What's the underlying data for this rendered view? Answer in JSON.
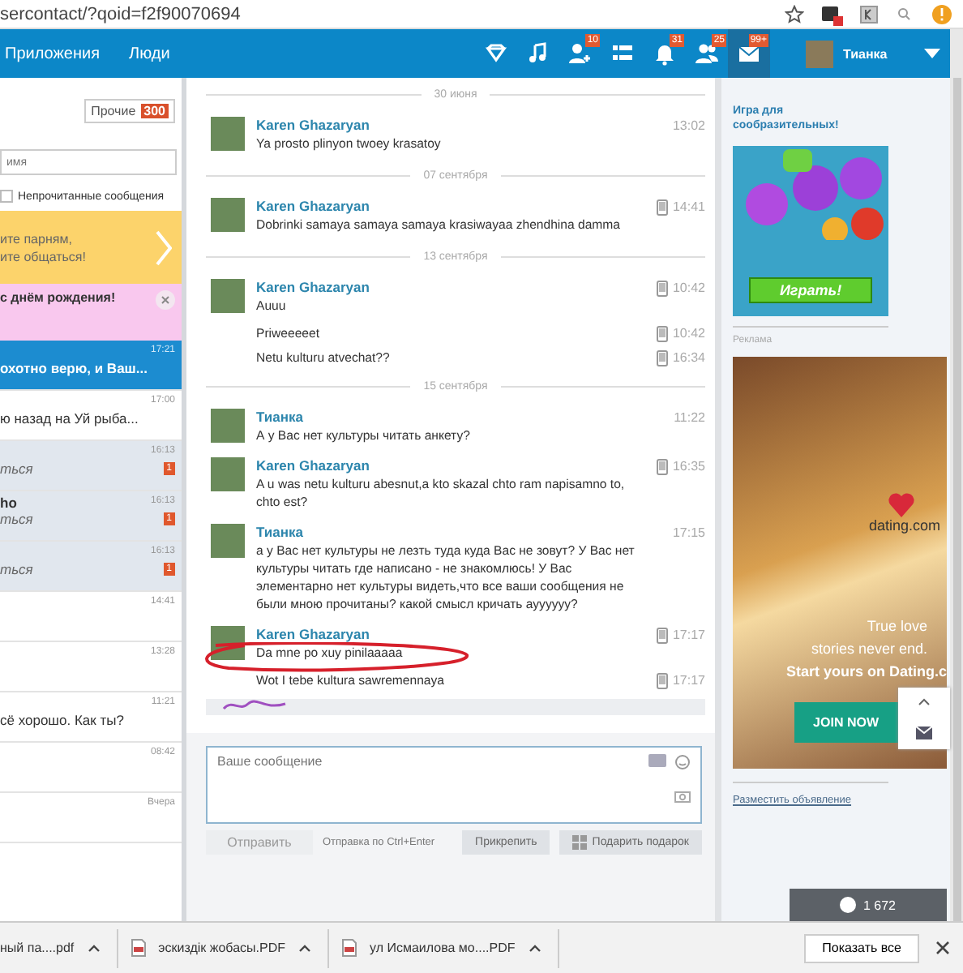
{
  "browser": {
    "url": "sercontact/?qoid=f2f90070694"
  },
  "nav": {
    "links": [
      "Приложения",
      "Люди"
    ],
    "icons": [
      {
        "kind": "diamond",
        "selected": false
      },
      {
        "kind": "music",
        "selected": false
      },
      {
        "kind": "friends",
        "badge": "10",
        "selected": false
      },
      {
        "kind": "list",
        "selected": false
      },
      {
        "kind": "bell",
        "badge": "31",
        "selected": false
      },
      {
        "kind": "people",
        "badge": "25",
        "selected": false
      },
      {
        "kind": "mail",
        "badge": "99+",
        "selected": true
      }
    ],
    "user": {
      "name": "Тианка"
    }
  },
  "sidebar": {
    "filter_tab": {
      "label": "Прочие",
      "count": "300"
    },
    "search": {
      "placeholder": "имя"
    },
    "unread_filter": {
      "label": "Непрочитанные сообщения",
      "checked": false
    },
    "promo": {
      "lines": [
        "ите парням,",
        "ите общаться!"
      ]
    },
    "birthday": {
      "text": "с днём рождения!"
    },
    "conversations": [
      {
        "preview": "охотно верю, и Ваш...",
        "time": "17:21",
        "selected": true
      },
      {
        "preview": "ю назад на Уй рыба...",
        "time": "17:00",
        "selected": false
      },
      {
        "preview": "ться",
        "time": "16:13",
        "selected": false,
        "unread": "1"
      },
      {
        "name": "ho",
        "preview": "ться",
        "time": "16:13",
        "selected": false,
        "unread": "1"
      },
      {
        "preview": "ться",
        "time": "16:13",
        "selected": false,
        "unread": "1"
      },
      {
        "time": "14:41",
        "selected": false
      },
      {
        "time": "13:28",
        "selected": false
      },
      {
        "preview": "сё хорошо. Как ты?",
        "time": "11:21",
        "selected": false
      },
      {
        "time": "08:42",
        "selected": false
      },
      {
        "time": "Вчера",
        "selected": false
      }
    ]
  },
  "chat": {
    "days": [
      {
        "date": "30 июня",
        "messages": [
          {
            "author": "Karen Ghazaryan",
            "text": "Ya prosto plinyon twoey krasatoy",
            "time": "13:02"
          }
        ]
      },
      {
        "date": "07 сентября",
        "messages": [
          {
            "author": "Karen Ghazaryan",
            "text": "Dobrinki samaya samaya samaya krasiwayaa zhendhina damma",
            "time": "14:41",
            "mobile": true
          }
        ]
      },
      {
        "date": "13 сентября",
        "messages": [
          {
            "author": "Karen Ghazaryan",
            "text": "Auuu",
            "time": "10:42",
            "mobile": true
          },
          {
            "text": "Priweeeeet",
            "time": "10:42",
            "mobile": true
          },
          {
            "text": "Netu kulturu atvechat??",
            "time": "16:34",
            "mobile": true
          }
        ]
      },
      {
        "date": "15 сентября",
        "messages": [
          {
            "author": "Тианка",
            "text": "А у Вас нет культуры читать анкету?",
            "time": "11:22"
          },
          {
            "author": "Karen Ghazaryan",
            "text": "A u was netu kulturu abesnut,a kto skazal chto ram napisamno to, chto est?",
            "time": "16:35",
            "mobile": true
          },
          {
            "author": "Тианка",
            "text": "а у Вас нет культуры не лезть туда куда Вас не зовут? У Вас нет культуры читать где написано - не знакомлюсь! У Вас элементарно нет культуры видеть,что все ваши сообщения не были мною прочитаны? какой смысл кричать ауууууу?",
            "time": "17:15"
          },
          {
            "author": "Karen Ghazaryan",
            "text": "Da mne po xuy pinilaaaaa",
            "time": "17:17",
            "mobile": true,
            "circled": true
          },
          {
            "text": "Wot I tebe kultura sawremennaya",
            "time": "17:17",
            "mobile": true
          }
        ]
      }
    ],
    "composer": {
      "placeholder": "Ваше сообщение",
      "send": "Отправить",
      "hint": "Отправка по Ctrl+Enter",
      "attach": "Прикрепить",
      "gift": "Подарить подарок"
    }
  },
  "right": {
    "game_title": "Игра для сообразительных!",
    "game_button": "Играть!",
    "ad_label": "Реклама",
    "banner": {
      "brand": "dating.com",
      "lines": [
        "True love",
        "stories never end."
      ],
      "headline": "Start yours on Dating.c",
      "button": "JOIN NOW"
    },
    "ad_link": "Разместить объявление",
    "counter": "1 672"
  },
  "downloads": {
    "items": [
      "ный па....pdf",
      "эскиздік жобасы.PDF",
      "ул Исмаилова мо....PDF"
    ],
    "show_all": "Показать все"
  }
}
